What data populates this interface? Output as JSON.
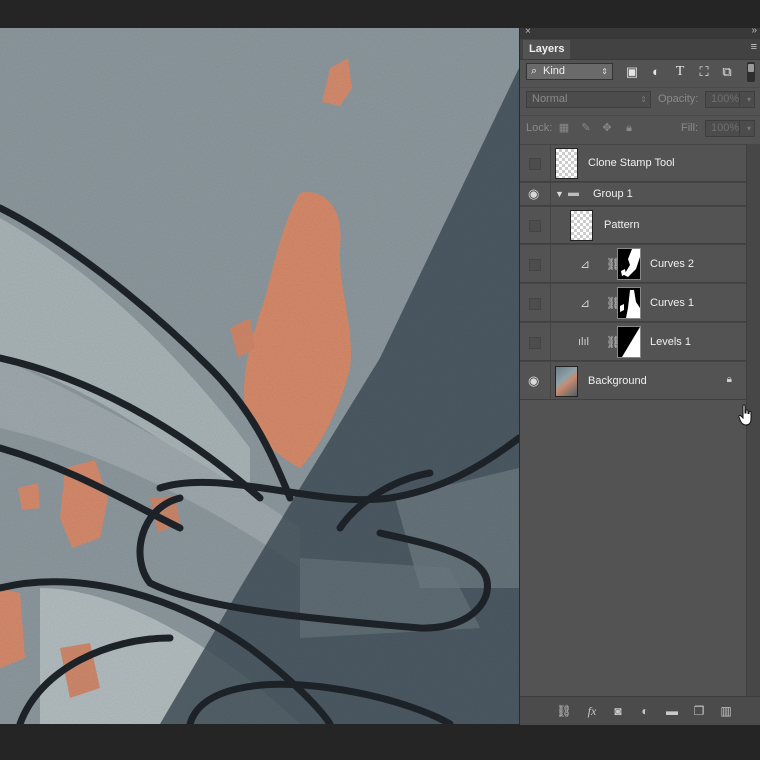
{
  "panel": {
    "title": "Layers",
    "close_glyph": "×",
    "collapse_glyph": "»",
    "menu_glyph": "≡"
  },
  "filter": {
    "kind_label": "Kind",
    "icons": [
      "image-filter-icon",
      "adjustment-filter-icon",
      "type-filter-icon",
      "shape-filter-icon",
      "smart-object-filter-icon"
    ]
  },
  "blend": {
    "mode": "Normal",
    "opacity_label": "Opacity:",
    "opacity_value": "100%",
    "lock_label": "Lock:",
    "fill_label": "Fill:",
    "fill_value": "100%"
  },
  "layers": [
    {
      "name": "Clone Stamp Tool",
      "visible": false,
      "type": "pixel"
    },
    {
      "name": "Group 1",
      "visible": true,
      "type": "group",
      "expanded": true
    },
    {
      "name": "Pattern",
      "visible": false,
      "type": "pixel"
    },
    {
      "name": "Curves 2",
      "visible": false,
      "type": "curves"
    },
    {
      "name": "Curves 1",
      "visible": false,
      "type": "curves"
    },
    {
      "name": "Levels 1",
      "visible": false,
      "type": "levels"
    },
    {
      "name": "Background",
      "visible": true,
      "type": "background",
      "locked": true
    }
  ],
  "bottom_tools": [
    "link-layers-icon",
    "fx-icon",
    "add-mask-icon",
    "new-adjustment-icon",
    "new-group-icon",
    "new-layer-icon",
    "delete-layer-icon"
  ],
  "colors": {
    "panel_bg": "#535353",
    "canvas_wall": "#8a959c",
    "paint_orange": "#d4896c",
    "shadow": "#3d4a52"
  }
}
